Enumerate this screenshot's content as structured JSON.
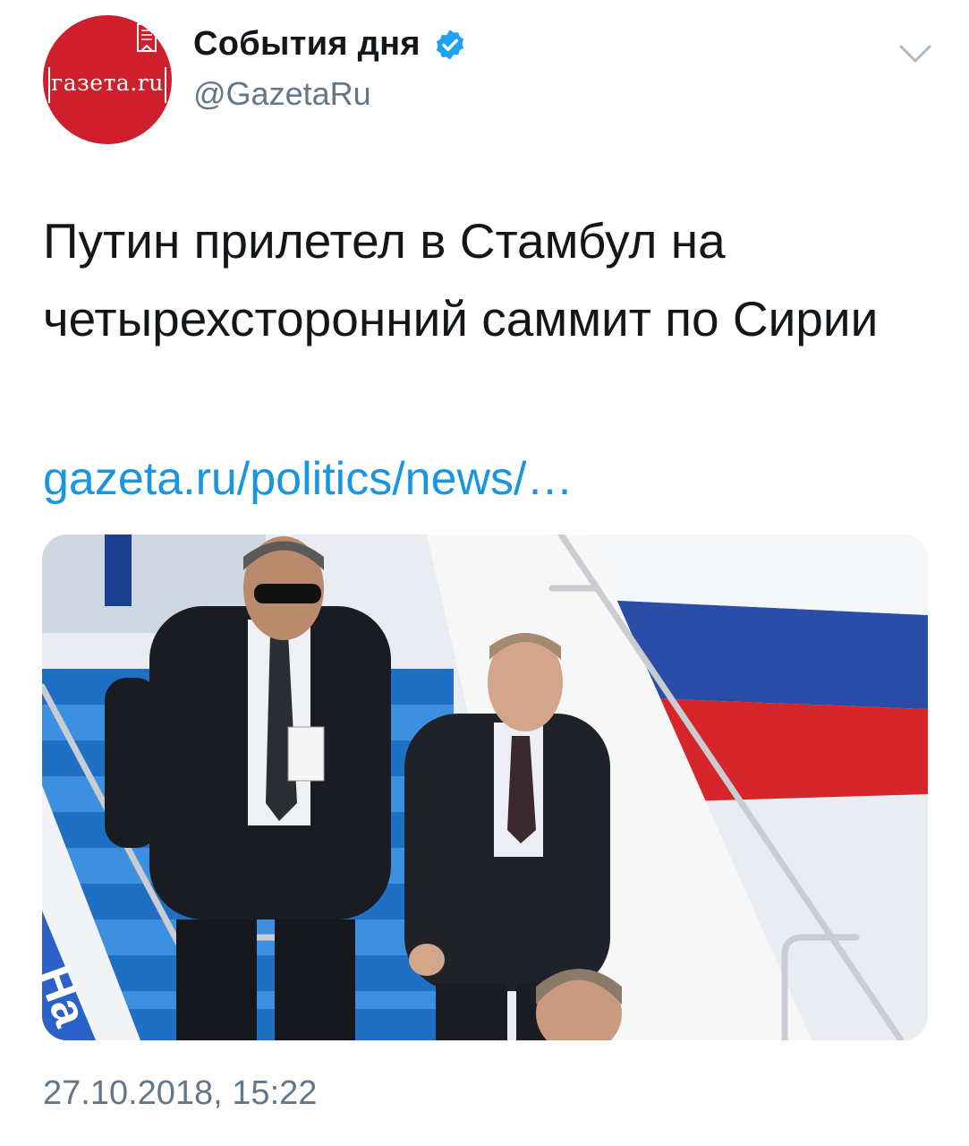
{
  "author": {
    "display_name": "События дня",
    "handle": "@GazetaRu",
    "avatar_text": "газета.ru",
    "avatar_color": "#cf1f2d"
  },
  "tweet": {
    "text": "Путин прилетел в Стамбул на четырехсторонний саммит по Сирии",
    "link_text": "gazeta.ru/politics/news/…",
    "timestamp": "27.10.2018, 15:22"
  },
  "media": {
    "description_icon": "photo-image"
  },
  "colors": {
    "link": "#1b95e0",
    "verified": "#1da1f2",
    "secondary_text": "#657786"
  }
}
